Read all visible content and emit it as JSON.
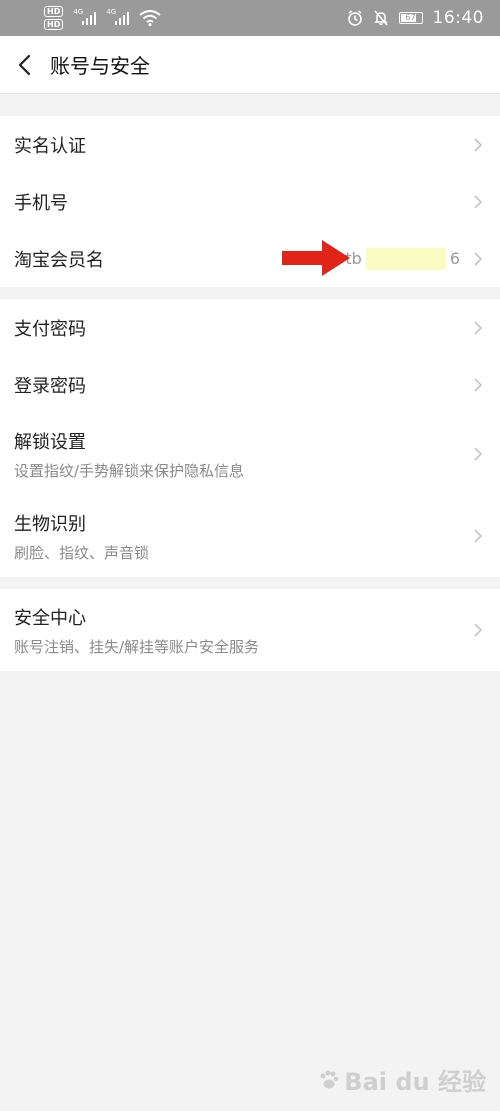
{
  "status": {
    "hd_badges": [
      "HD",
      "HD"
    ],
    "network_left": "4G",
    "network_right": "4G",
    "battery": "67",
    "time": "16:40"
  },
  "nav": {
    "title": "账号与安全"
  },
  "groups": {
    "account": {
      "real_name": "实名认证",
      "phone": "手机号",
      "taobao_name": "淘宝会员名",
      "taobao_value_prefix": "tb",
      "taobao_value_suffix": "6"
    },
    "security": {
      "pay_password": "支付密码",
      "login_password": "登录密码",
      "unlock_settings": "解锁设置",
      "unlock_settings_sub": "设置指纹/手势解锁来保护隐私信息",
      "biometrics": "生物识别",
      "biometrics_sub": "刷脸、指纹、声音锁"
    },
    "center": {
      "security_center": "安全中心",
      "security_center_sub": "账号注销、挂失/解挂等账户安全服务"
    }
  },
  "annotation": {
    "arrow_color": "#e2231a"
  },
  "watermark": {
    "text": "Bai du 经验"
  },
  "icons": [
    "back-arrow-icon",
    "chevron-right-icon",
    "alarm-icon",
    "mute-bell-icon",
    "wifi-icon",
    "signal-icon",
    "battery-icon",
    "red-arrow-icon"
  ]
}
